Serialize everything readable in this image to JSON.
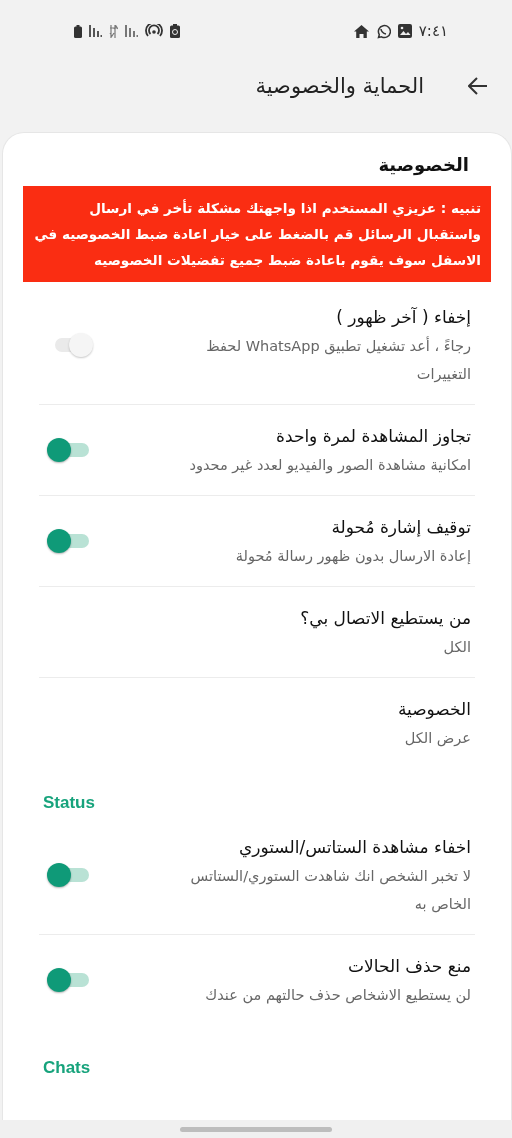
{
  "status_bar": {
    "time": "٧:٤١"
  },
  "app_bar": {
    "title": "الحماية والخصوصية"
  },
  "privacy": {
    "heading": "الخصوصية",
    "warning": "تنبيه : عزيزي المستخدم اذا واجهتك مشكلة تأخر في ارسال واستقبال الرسائل قم بالضغط على خيار اعادة ضبط الخصوصيه في الاسفل سوف يقوم باعادة ضبط جميع تفضيلات الخصوصيه",
    "items": [
      {
        "kind": "switch",
        "title": "إخفاء ( آخر ظهور )",
        "subtitle": "رجاءً ، أعد تشغيل تطبيق WhatsApp لحفظ التغييرات",
        "on": false,
        "disabled": true
      },
      {
        "kind": "switch",
        "title": "تجاوز المشاهدة لمرة واحدة",
        "subtitle": "امكانية مشاهدة الصور والفيديو لعدد غير محدود",
        "on": true,
        "disabled": false
      },
      {
        "kind": "switch",
        "title": "توقيف إشارة مُحولة",
        "subtitle": "إعادة الارسال بدون ظهور رسالة مُحولة",
        "on": true,
        "disabled": false
      },
      {
        "kind": "choice",
        "title": "من يستطيع الاتصال بي؟",
        "subtitle": "الكل"
      },
      {
        "kind": "choice",
        "title": "الخصوصية",
        "subtitle": "عرض الكل"
      }
    ]
  },
  "sections": [
    {
      "title": "Status",
      "items": [
        {
          "kind": "switch",
          "title": "اخفاء مشاهدة الستاتس/الستوري",
          "subtitle": "لا تخبر الشخص انك شاهدت الستوري/الستاتس الخاص به",
          "on": true,
          "disabled": false
        },
        {
          "kind": "switch",
          "title": "منع حذف الحالات",
          "subtitle": "لن يستطيع الاشخاص حذف حالتهم من عندك",
          "on": true,
          "disabled": false
        }
      ]
    },
    {
      "title": "Chats"
    }
  ]
}
